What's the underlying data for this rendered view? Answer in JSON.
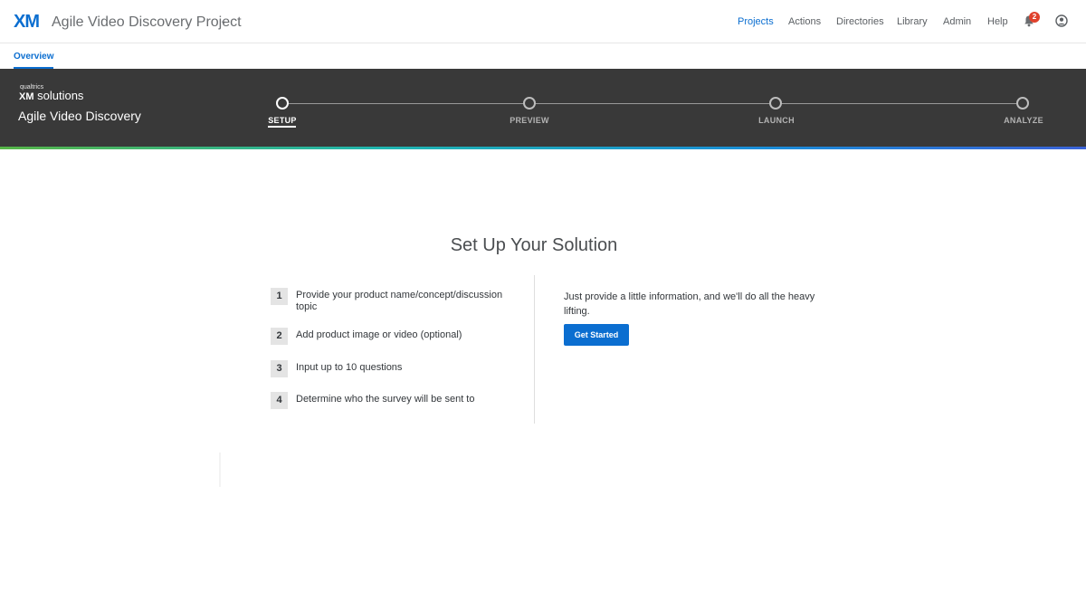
{
  "header": {
    "logo": "XM",
    "project_title": "Agile Video Discovery Project",
    "caret": "⌄",
    "nav": [
      "Projects",
      "Actions",
      "Directories",
      "Library",
      "Admin",
      "Help"
    ],
    "active_nav": "Projects",
    "notification_count": "2",
    "accent_color": "#0b6ed0"
  },
  "subnav": {
    "overview": "Overview"
  },
  "banner": {
    "brand_small": "qualtrics",
    "brand_xm": "XM",
    "brand_solutions": "solutions",
    "title": "Agile Video Discovery",
    "steps": [
      "SETUP",
      "PREVIEW",
      "LAUNCH",
      "ANALYZE"
    ],
    "active_step": "SETUP"
  },
  "main": {
    "heading": "Set Up Your Solution",
    "steps": [
      {
        "num": "1",
        "text": "Provide your product name/concept/discussion topic"
      },
      {
        "num": "2",
        "text": "Add product image or video (optional)"
      },
      {
        "num": "3",
        "text": "Input up to 10 questions"
      },
      {
        "num": "4",
        "text": "Determine who the survey will be sent to"
      }
    ],
    "intro": "Just provide a little information, and we'll do all the heavy lifting.",
    "cta": "Get Started"
  },
  "icons": {
    "notifications": "bell-icon",
    "account": "user-circle-icon",
    "dropdown": "chevron-down-icon"
  }
}
